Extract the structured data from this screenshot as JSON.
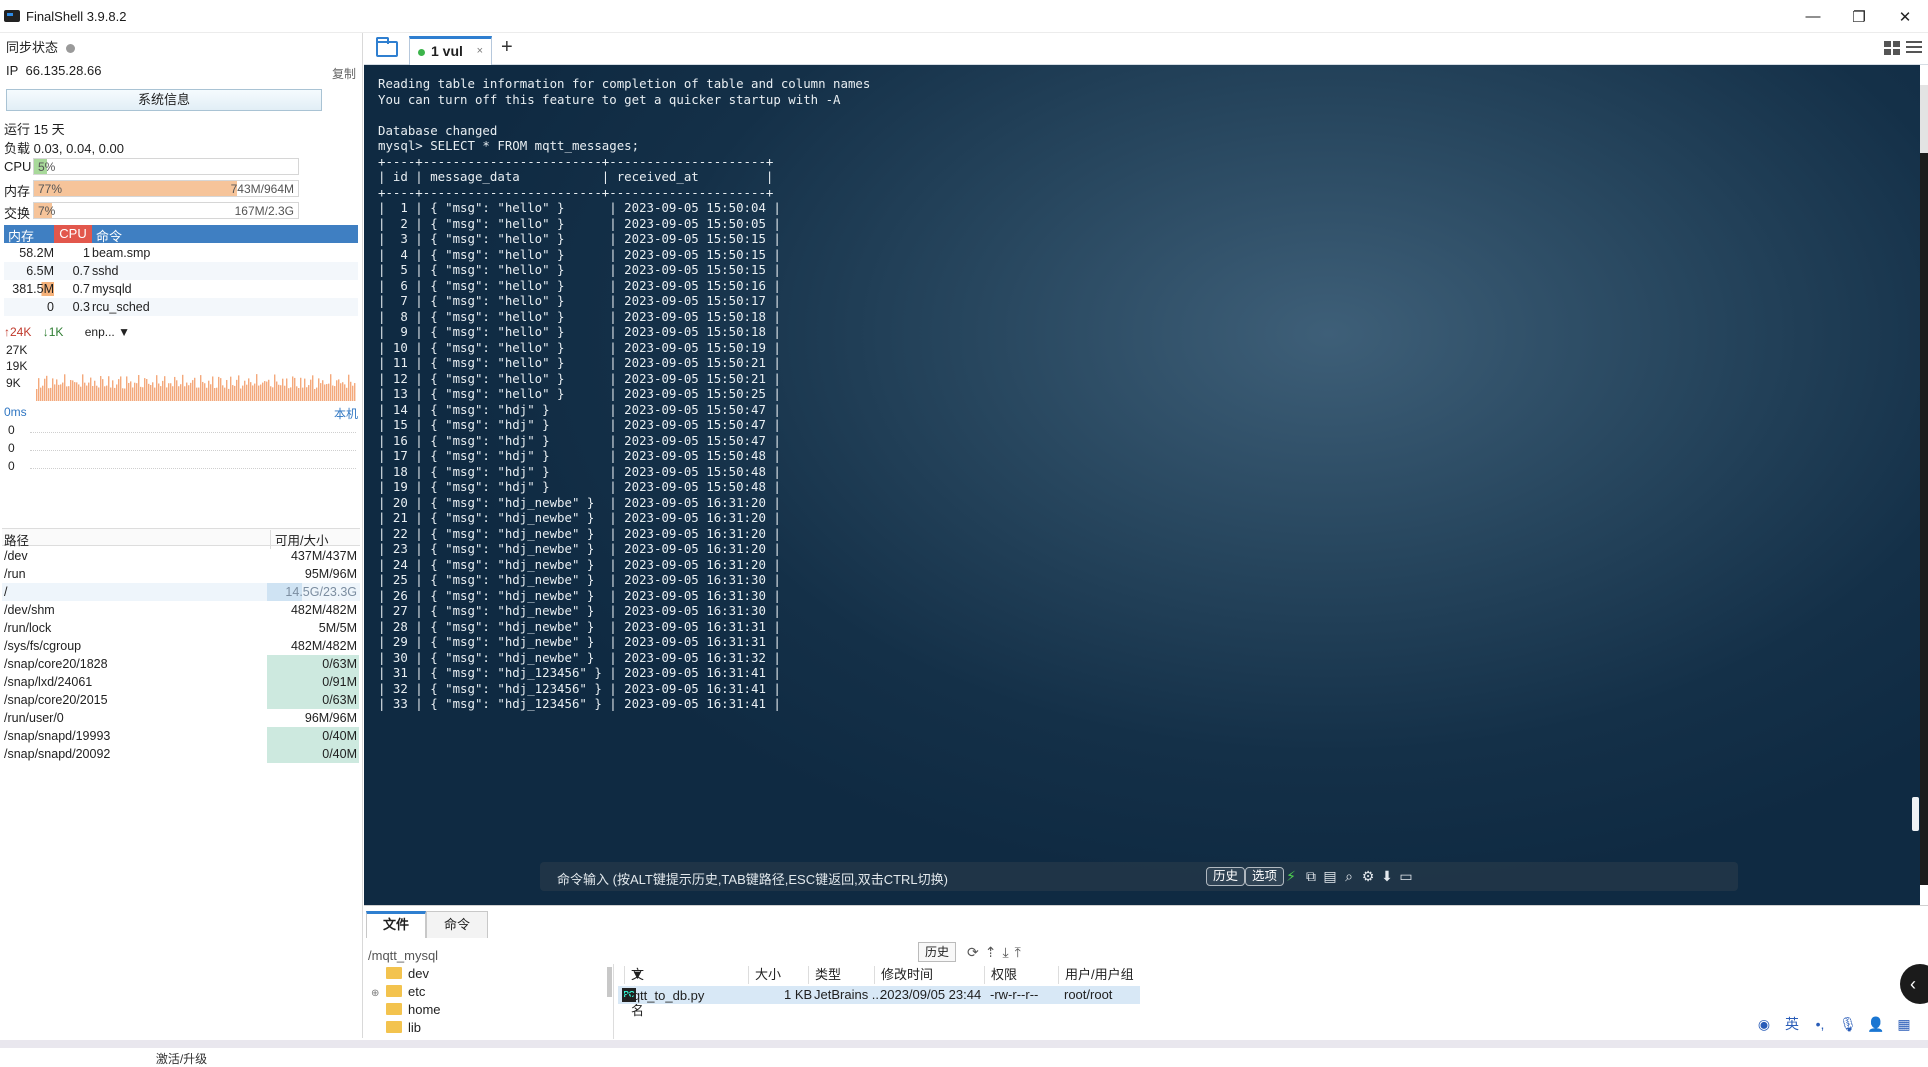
{
  "window": {
    "title": "FinalShell 3.9.8.2",
    "minimize": "—",
    "restore": "❐",
    "close": "✕"
  },
  "left": {
    "sync_label": "同步状态",
    "ip_label": "IP",
    "ip_value": "66.135.28.66",
    "copy": "复制",
    "sysinfo": "系统信息",
    "uptime": "运行 15 天",
    "load": "负载 0.03, 0.04, 0.00",
    "cpu": {
      "label": "CPU",
      "pct": "5%",
      "fraction": 0.05,
      "color": "#a8d99a"
    },
    "mem": {
      "label": "内存",
      "pct": "77%",
      "amount": "743M/964M",
      "fraction": 0.77,
      "color": "#f6c49a"
    },
    "swap": {
      "label": "交换",
      "pct": "7%",
      "amount": "167M/2.3G",
      "fraction": 0.07,
      "color": "#f6c49a"
    },
    "proc_headers": {
      "mem": "内存",
      "cpu": "CPU",
      "cmd": "命令"
    },
    "processes": [
      {
        "mem": "58.2M",
        "cpu": "1",
        "cmd": "beam.smp"
      },
      {
        "mem": "6.5M",
        "cpu": "0.7",
        "cmd": "sshd"
      },
      {
        "mem": "381.5M",
        "cpu": "0.7",
        "cmd": "mysqld"
      },
      {
        "mem": "0",
        "cpu": "0.3",
        "cmd": "rcu_sched"
      }
    ],
    "net": {
      "up": "24K",
      "down": "1K",
      "iface": "enp..."
    },
    "traffic_axis": [
      "27K",
      "19K",
      "9K"
    ],
    "ping": {
      "latency": "0ms",
      "target": "本机",
      "values": [
        "0",
        "0",
        "0"
      ]
    },
    "fs_headers": {
      "path": "路径",
      "avail": "可用/大小"
    },
    "filesystems": [
      {
        "path": "/dev",
        "avail": "437M/437M",
        "used": 0
      },
      {
        "path": "/run",
        "avail": "95M/96M",
        "used": 0.01
      },
      {
        "path": "/",
        "avail": "14.5G/23.3G",
        "used": 0.38
      },
      {
        "path": "/dev/shm",
        "avail": "482M/482M",
        "used": 0
      },
      {
        "path": "/run/lock",
        "avail": "5M/5M",
        "used": 0
      },
      {
        "path": "/sys/fs/cgroup",
        "avail": "482M/482M",
        "used": 0
      },
      {
        "path": "/snap/core20/1828",
        "avail": "0/63M",
        "used": 1
      },
      {
        "path": "/snap/lxd/24061",
        "avail": "0/91M",
        "used": 1
      },
      {
        "path": "/snap/core20/2015",
        "avail": "0/63M",
        "used": 1
      },
      {
        "path": "/run/user/0",
        "avail": "96M/96M",
        "used": 0
      },
      {
        "path": "/snap/snapd/19993",
        "avail": "0/40M",
        "used": 1
      },
      {
        "path": "/snap/snapd/20092",
        "avail": "0/40M",
        "used": 1
      }
    ],
    "activate": "激活/升级"
  },
  "tabs": {
    "active": "1 vul",
    "close": "×",
    "add": "+"
  },
  "terminal": {
    "lines": [
      "Reading table information for completion of table and column names",
      "You can turn off this feature to get a quicker startup with -A",
      "",
      "Database changed",
      "mysql> SELECT * FROM mqtt_messages;",
      "+----+------------------------+---------------------+",
      "| id | message_data           | received_at         |",
      "+----+------------------------+---------------------+",
      "|  1 | { \"msg\": \"hello\" }      | 2023-09-05 15:50:04 |",
      "|  2 | { \"msg\": \"hello\" }      | 2023-09-05 15:50:05 |",
      "|  3 | { \"msg\": \"hello\" }      | 2023-09-05 15:50:15 |",
      "|  4 | { \"msg\": \"hello\" }      | 2023-09-05 15:50:15 |",
      "|  5 | { \"msg\": \"hello\" }      | 2023-09-05 15:50:15 |",
      "|  6 | { \"msg\": \"hello\" }      | 2023-09-05 15:50:16 |",
      "|  7 | { \"msg\": \"hello\" }      | 2023-09-05 15:50:17 |",
      "|  8 | { \"msg\": \"hello\" }      | 2023-09-05 15:50:18 |",
      "|  9 | { \"msg\": \"hello\" }      | 2023-09-05 15:50:18 |",
      "| 10 | { \"msg\": \"hello\" }      | 2023-09-05 15:50:19 |",
      "| 11 | { \"msg\": \"hello\" }      | 2023-09-05 15:50:21 |",
      "| 12 | { \"msg\": \"hello\" }      | 2023-09-05 15:50:21 |",
      "| 13 | { \"msg\": \"hello\" }      | 2023-09-05 15:50:25 |",
      "| 14 | { \"msg\": \"hdj\" }        | 2023-09-05 15:50:47 |",
      "| 15 | { \"msg\": \"hdj\" }        | 2023-09-05 15:50:47 |",
      "| 16 | { \"msg\": \"hdj\" }        | 2023-09-05 15:50:47 |",
      "| 17 | { \"msg\": \"hdj\" }        | 2023-09-05 15:50:48 |",
      "| 18 | { \"msg\": \"hdj\" }        | 2023-09-05 15:50:48 |",
      "| 19 | { \"msg\": \"hdj\" }        | 2023-09-05 15:50:48 |",
      "| 20 | { \"msg\": \"hdj_newbe\" }  | 2023-09-05 16:31:20 |",
      "| 21 | { \"msg\": \"hdj_newbe\" }  | 2023-09-05 16:31:20 |",
      "| 22 | { \"msg\": \"hdj_newbe\" }  | 2023-09-05 16:31:20 |",
      "| 23 | { \"msg\": \"hdj_newbe\" }  | 2023-09-05 16:31:20 |",
      "| 24 | { \"msg\": \"hdj_newbe\" }  | 2023-09-05 16:31:20 |",
      "| 25 | { \"msg\": \"hdj_newbe\" }  | 2023-09-05 16:31:30 |",
      "| 26 | { \"msg\": \"hdj_newbe\" }  | 2023-09-05 16:31:30 |",
      "| 27 | { \"msg\": \"hdj_newbe\" }  | 2023-09-05 16:31:30 |",
      "| 28 | { \"msg\": \"hdj_newbe\" }  | 2023-09-05 16:31:31 |",
      "| 29 | { \"msg\": \"hdj_newbe\" }  | 2023-09-05 16:31:31 |",
      "| 30 | { \"msg\": \"hdj_newbe\" }  | 2023-09-05 16:31:32 |",
      "| 31 | { \"msg\": \"hdj_123456\" } | 2023-09-05 16:31:41 |",
      "| 32 | { \"msg\": \"hdj_123456\" } | 2023-09-05 16:31:41 |",
      "| 33 | { \"msg\": \"hdj_123456\" } | 2023-09-05 16:31:41 |"
    ],
    "cmd_hint": "命令输入 (按ALT键提示历史,TAB键路径,ESC键返回,双击CTRL切换)",
    "history_btn": "历史",
    "options_btn": "选项"
  },
  "bottom": {
    "tab_files": "文件",
    "tab_commands": "命令",
    "path": "/mqtt_mysql",
    "history": "历史",
    "tree": [
      "dev",
      "etc",
      "home",
      "lib"
    ],
    "columns": {
      "name": "文件名",
      "size": "大小",
      "type": "类型",
      "mtime": "修改时间",
      "perm": "权限",
      "owner": "用户/用户组"
    },
    "files": [
      {
        "name": "mqtt_to_db.py",
        "size": "1 KB",
        "type": "JetBrains ...",
        "mtime": "2023/09/05 23:44",
        "perm": "-rw-r--r--",
        "owner": "root/root"
      }
    ]
  },
  "ime": {
    "lang": "英"
  }
}
